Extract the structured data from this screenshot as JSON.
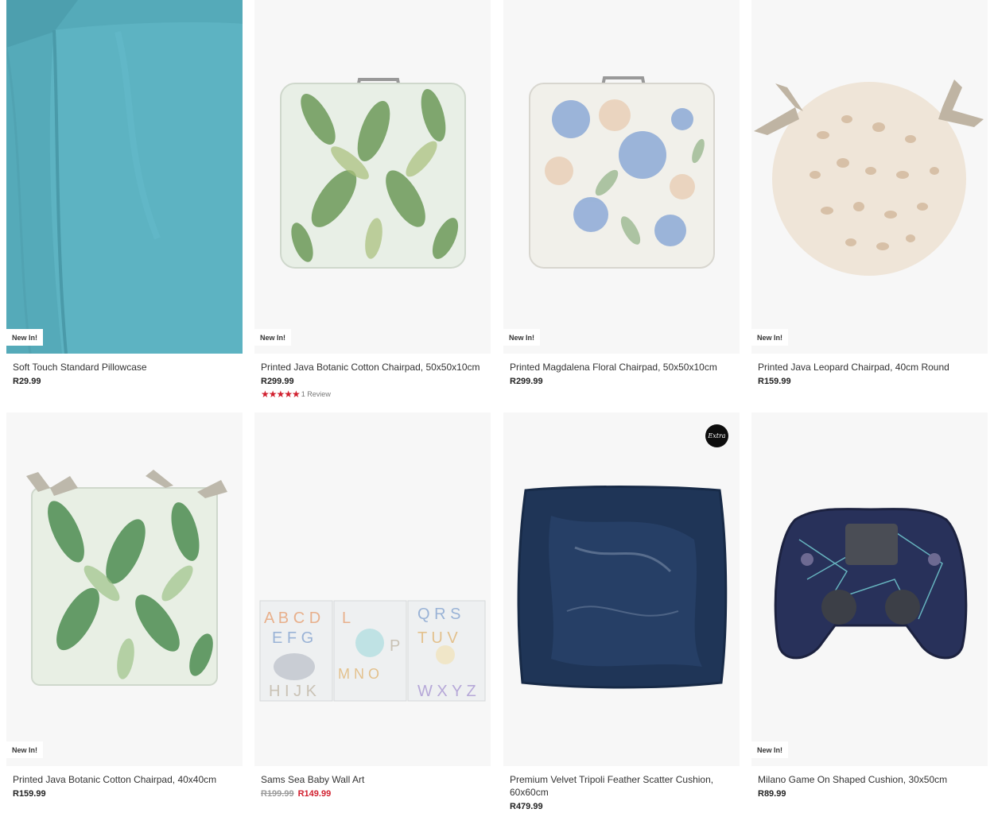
{
  "products": [
    {
      "title": "Soft Touch Standard Pillowcase",
      "price": "R29.99",
      "badge": "New In!"
    },
    {
      "title": "Printed Java Botanic Cotton Chairpad, 50x50x10cm",
      "price": "R299.99",
      "badge": "New In!",
      "rating": {
        "stars": 5,
        "label": "1 Review"
      }
    },
    {
      "title": "Printed Magdalena Floral Chairpad, 50x50x10cm",
      "price": "R299.99",
      "badge": "New In!"
    },
    {
      "title": "Printed Java Leopard Chairpad, 40cm Round",
      "price": "R159.99",
      "badge": "New In!"
    },
    {
      "title": "Printed Java Botanic Cotton Chairpad, 40x40cm",
      "price": "R159.99",
      "badge": "New In!"
    },
    {
      "title": "Sams Sea Baby Wall Art",
      "was_price": "R199.99",
      "sale_price": "R149.99"
    },
    {
      "title": "Premium Velvet Tripoli Feather Scatter Cushion, 60x60cm",
      "price": "R479.99",
      "corner_badge": "Extra"
    },
    {
      "title": "Milano Game On Shaped Cushion, 30x50cm",
      "price": "R89.99",
      "badge": "New In!"
    }
  ],
  "wall_art_letters": {
    "panel1_top": "A B C D",
    "panel1_mid": "E F G",
    "panel1_bottom": "H I J K",
    "panel2_top": "L",
    "panel2_right": "P",
    "panel2_bottom": "M N O",
    "panel3_top": "Q R S",
    "panel3_mid": "T U V",
    "panel3_bottom": "W X Y Z"
  },
  "colors": {
    "sale_red": "#d11f2e",
    "card_bg": "#f7f7f7"
  }
}
